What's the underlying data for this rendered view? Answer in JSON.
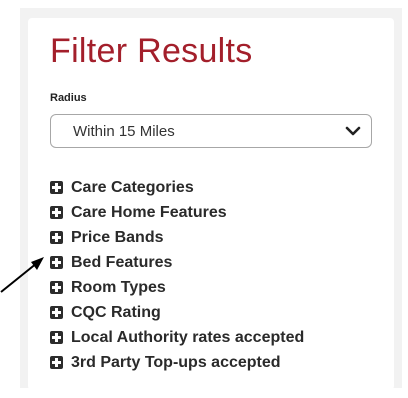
{
  "panel": {
    "title": "Filter Results",
    "radius": {
      "label": "Radius",
      "selected": "Within 15 Miles",
      "icon": "chevron-down-icon"
    },
    "filters": [
      {
        "label": "Care Categories",
        "icon": "plus-square-icon"
      },
      {
        "label": "Care Home Features",
        "icon": "plus-square-icon"
      },
      {
        "label": "Price Bands",
        "icon": "plus-square-icon"
      },
      {
        "label": "Bed Features",
        "icon": "plus-square-icon"
      },
      {
        "label": "Room Types",
        "icon": "plus-square-icon"
      },
      {
        "label": "CQC Rating",
        "icon": "plus-square-icon"
      },
      {
        "label": "Local Authority rates accepted",
        "icon": "plus-square-icon"
      },
      {
        "label": "3rd Party Top-ups accepted",
        "icon": "plus-square-icon"
      }
    ]
  },
  "colors": {
    "title": "#a31f2b",
    "outer_background": "#f2f2f2",
    "panel_background": "#ffffff",
    "text": "#2a2a2a",
    "annotation_arrow": "#000000"
  }
}
